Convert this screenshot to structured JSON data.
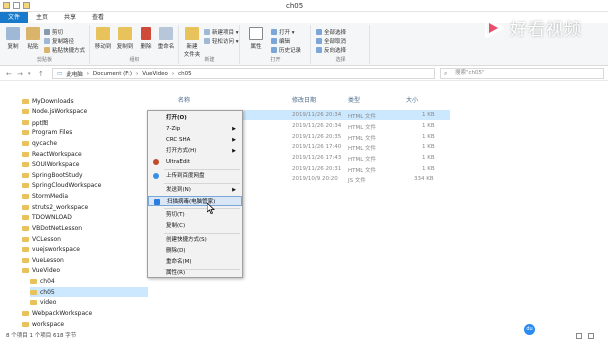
{
  "window": {
    "title": "ch05"
  },
  "ribbon": {
    "tabs": [
      "文件",
      "主页",
      "共享",
      "查看"
    ],
    "clipboard": {
      "label": "剪贴板",
      "copy": "复制",
      "paste": "粘贴",
      "cut": "剪切",
      "copy_path": "复制路径",
      "paste_shortcut": "粘贴快捷方式"
    },
    "organize": {
      "label": "组织",
      "move_to": "移动到",
      "copy_to": "复制到",
      "delete": "删除",
      "rename": "重命名"
    },
    "new": {
      "label": "新建",
      "new_folder": "新建\n文件夹",
      "new_item": "新建项目 ▾",
      "easy_access": "轻松访问 ▾"
    },
    "open": {
      "label": "打开",
      "properties": "属性",
      "open": "打开 ▾",
      "edit": "编辑",
      "history": "历史记录"
    },
    "select": {
      "label": "选择",
      "select_all": "全部选择",
      "select_none": "全部取消",
      "invert": "反向选择"
    }
  },
  "address": {
    "crumbs": [
      "此电脑",
      "Document (F:)",
      "VueVideo",
      "ch05"
    ],
    "search_placeholder": "搜索\"ch05\""
  },
  "nav": {
    "items": [
      "MyDownloads",
      "Node.jsWorkspace",
      "ppt图",
      "Program Files",
      "qycache",
      "ReactWorkspace",
      "SOUIWorkspace",
      "SpringBootStudy",
      "SpringCloudWorkspace",
      "StormMedia",
      "struts2_workspace",
      "TDOWNLOAD",
      "VBDotNetLesson",
      "VCLesson",
      "vuejsworkspace",
      "VueLesson",
      "VueVideo",
      "ch04",
      "ch05",
      "video",
      "WebpackWorkspace",
      "workspace"
    ]
  },
  "content": {
    "columns": {
      "name": "名称",
      "modified": "修改日期",
      "type": "类型",
      "size": "大小"
    },
    "rows": [
      {
        "name": "",
        "tail": "ml",
        "modified": "2019/11/26 20:34",
        "type": "HTML 文件",
        "size": "1 KB"
      },
      {
        "name": "",
        "tail": "",
        "modified": "2019/11/26 20:34",
        "type": "HTML 文件",
        "size": "1 KB"
      },
      {
        "name": "",
        "tail": "",
        "modified": "2019/11/26 20:35",
        "type": "HTML 文件",
        "size": "1 KB"
      },
      {
        "name": "",
        "tail": "",
        "modified": "2019/11/26 17:40",
        "type": "HTML 文件",
        "size": "1 KB"
      },
      {
        "name": "",
        "tail": "",
        "modified": "2019/11/26 17:43",
        "type": "HTML 文件",
        "size": "1 KB"
      },
      {
        "name": "",
        "tail": "",
        "modified": "2019/11/26 20:31",
        "type": "HTML 文件",
        "size": "1 KB"
      },
      {
        "name": "",
        "tail": "",
        "modified": "2019/10/9 20:20",
        "type": "JS 文件",
        "size": "334 KB"
      }
    ]
  },
  "context_menu": {
    "items": [
      {
        "label": "打开(O)",
        "bold": true
      },
      {
        "label": "7-Zip",
        "sub": true
      },
      {
        "label": "CRC SHA",
        "sub": true
      },
      {
        "label": "打开方式(H)",
        "sub": true
      },
      {
        "label": "UltraEdit"
      },
      {
        "label": "上传到百度网盘"
      },
      {
        "label": "发送到(N)",
        "sub": true
      },
      {
        "label": "扫描病毒(电脑管家)",
        "highlighted": true
      },
      {
        "label": "剪切(T)"
      },
      {
        "label": "复制(C)"
      },
      {
        "label": "创建快捷方式(S)"
      },
      {
        "label": "删除(D)"
      },
      {
        "label": "重命名(M)"
      },
      {
        "label": "属性(R)"
      }
    ]
  },
  "status": {
    "text": "8 个项目    1 个项目 618 字节"
  },
  "watermark": {
    "text": "好看视频",
    "badge": "du"
  },
  "colors": {
    "accent": "#1979ca",
    "selection": "#cce8ff",
    "folder": "#e8c25a"
  }
}
